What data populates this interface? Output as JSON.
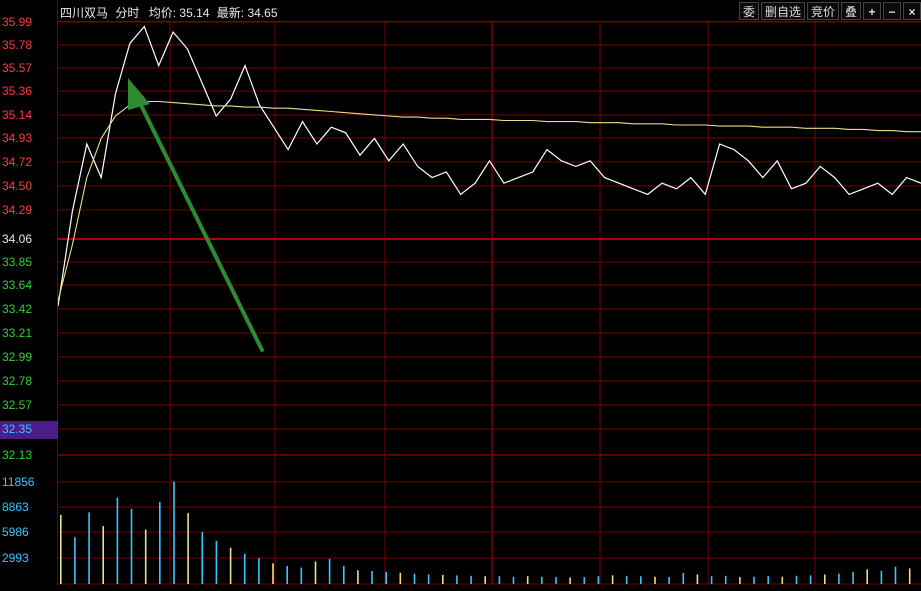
{
  "window": {
    "stock_name": "四川双马",
    "view_label": "分时",
    "avg_price_label": "均价:",
    "avg_price_value": "35.14",
    "last_price_label": "最新:",
    "last_price_value": "34.65"
  },
  "toolbar": {
    "buttons": [
      "委",
      "删自选",
      "竞价",
      "叠"
    ],
    "icons": [
      {
        "name": "plus-icon",
        "glyph": "+"
      },
      {
        "name": "minus-icon",
        "glyph": "−"
      },
      {
        "name": "close-icon",
        "glyph": "×"
      }
    ]
  },
  "price_axis": {
    "ticks": [
      "35.99",
      "35.78",
      "35.57",
      "35.36",
      "35.14",
      "34.93",
      "34.72",
      "34.50",
      "34.29",
      "34.06",
      "33.85",
      "33.64",
      "33.42",
      "33.21",
      "32.99",
      "32.78",
      "32.57",
      "32.35"
    ],
    "prev_close": "34.06",
    "highlighted": "32.35"
  },
  "volume_axis": {
    "ticks": [
      "32.13",
      "11856",
      "8863",
      "5986",
      "2993"
    ]
  },
  "colors": {
    "background": "#000000",
    "grid": "#7a0000",
    "prev_close_line": "#b00000",
    "up_text": "#ff3b3b",
    "down_text": "#2fd12f",
    "neutral_text": "#e8e8e8",
    "volume_axis_text": "#35c8ff",
    "price_line": "#ffffff",
    "avg_line": "#e8e08a",
    "arrow": "#2e8b2e",
    "volume_bar": "#35c8ff",
    "volume_bar_highlight": "#e8e08a"
  },
  "chart_data": {
    "type": "line",
    "title": "",
    "xlabel": "",
    "ylabel": "",
    "ylim": [
      32.13,
      35.99
    ],
    "x": [
      0,
      4,
      8,
      12,
      16,
      20,
      24,
      28,
      32,
      36,
      40,
      44,
      48,
      52,
      56,
      60,
      64,
      68,
      72,
      76,
      80,
      84,
      88,
      92,
      96,
      100,
      104,
      108,
      112,
      116,
      120,
      124,
      128,
      132,
      136,
      140,
      144,
      148,
      152,
      156,
      160,
      164,
      168,
      172,
      176,
      180,
      184,
      188,
      192,
      196,
      200,
      204,
      208,
      212,
      216,
      220,
      224,
      228,
      232,
      236,
      240
    ],
    "series": [
      {
        "values": [
          33.45,
          34.3,
          34.9,
          34.6,
          35.35,
          35.8,
          35.95,
          35.6,
          35.9,
          35.75,
          35.45,
          35.15,
          35.3,
          35.6,
          35.25,
          35.05,
          34.85,
          35.1,
          34.9,
          35.05,
          35.0,
          34.8,
          34.95,
          34.75,
          34.9,
          34.7,
          34.6,
          34.65,
          34.45,
          34.55,
          34.75,
          34.55,
          34.6,
          34.65,
          34.85,
          34.75,
          34.7,
          34.75,
          34.6,
          34.55,
          34.5,
          34.45,
          34.55,
          34.5,
          34.6,
          34.45,
          34.9,
          34.85,
          34.75,
          34.6,
          34.75,
          34.5,
          34.55,
          34.7,
          34.6,
          34.45,
          34.5,
          34.55,
          34.45,
          34.6,
          34.55
        ]
      },
      {
        "values": [
          33.5,
          34.0,
          34.6,
          34.95,
          35.15,
          35.25,
          35.28,
          35.28,
          35.27,
          35.26,
          35.25,
          35.24,
          35.24,
          35.23,
          35.23,
          35.22,
          35.22,
          35.21,
          35.2,
          35.19,
          35.18,
          35.17,
          35.16,
          35.15,
          35.14,
          35.14,
          35.13,
          35.13,
          35.12,
          35.12,
          35.12,
          35.11,
          35.11,
          35.11,
          35.1,
          35.1,
          35.1,
          35.09,
          35.09,
          35.09,
          35.08,
          35.08,
          35.08,
          35.07,
          35.07,
          35.07,
          35.06,
          35.06,
          35.06,
          35.05,
          35.05,
          35.05,
          35.04,
          35.04,
          35.04,
          35.03,
          35.03,
          35.02,
          35.02,
          35.01,
          35.01
        ]
      }
    ],
    "volume": [
      8000,
      5400,
      8300,
      6700,
      10000,
      8700,
      6300,
      9500,
      11856,
      8200,
      6000,
      5000,
      4200,
      3500,
      3000,
      2400,
      2100,
      1900,
      2600,
      2900,
      2100,
      1600,
      1500,
      1400,
      1300,
      1200,
      1100,
      1050,
      1000,
      950,
      900,
      900,
      850,
      900,
      850,
      800,
      750,
      800,
      900,
      1000,
      950,
      900,
      850,
      800,
      1300,
      1100,
      900,
      950,
      800,
      850,
      900,
      850,
      950,
      1000,
      1100,
      1200,
      1400,
      1700,
      1500,
      2000,
      1800
    ],
    "volume_ylim": [
      0,
      14000
    ]
  }
}
